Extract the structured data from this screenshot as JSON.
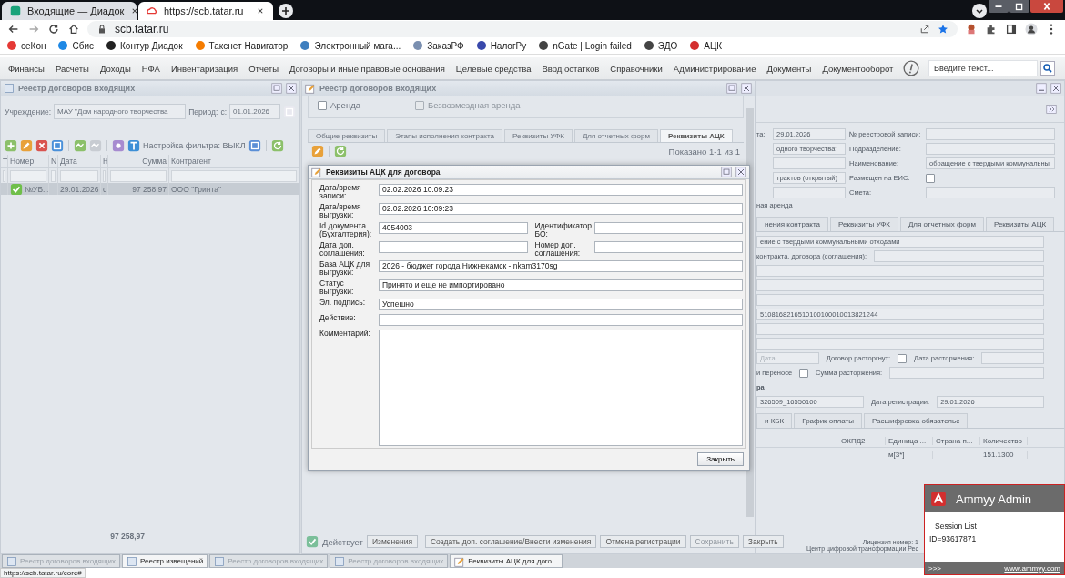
{
  "browser": {
    "tabs": [
      {
        "title": "Входящие — Диадок",
        "selected": false
      },
      {
        "title": "https://scb.tatar.ru",
        "selected": true
      }
    ],
    "address": "scb.tatar.ru",
    "bookmarks": [
      {
        "label": "сеКон",
        "color": "#e53935"
      },
      {
        "label": "Сбис",
        "color": "#1e88e5"
      },
      {
        "label": "Контур Диадок",
        "color": "#222222"
      },
      {
        "label": "Такснет Навигатор",
        "color": "#f57c00"
      },
      {
        "label": "Электронный мага...",
        "color": "#3f7fbf"
      },
      {
        "label": "ЗаказРФ",
        "color": "#7a8fb0"
      },
      {
        "label": "НалогРу",
        "color": "#3949ab"
      },
      {
        "label": "nGate | Login failed",
        "color": "#444444"
      },
      {
        "label": "ЭДО",
        "color": "#444444"
      },
      {
        "label": "АЦК",
        "color": "#d32f2f"
      }
    ]
  },
  "menu": {
    "items": [
      "Финансы",
      "Расчеты",
      "Доходы",
      "НФА",
      "Инвентаризация",
      "Отчеты",
      "Договоры и иные правовые основания",
      "Целевые средства",
      "Ввод остатков",
      "Справочники",
      "Администрирование",
      "Документы",
      "Документооборот"
    ],
    "search_placeholder": "Введите текст..."
  },
  "left_window": {
    "title": "Реестр договоров входящих",
    "institution_label": "Учреждение:",
    "institution": "МАУ \"Дом народного творчества",
    "period_label": "Период:",
    "from_label": "с:",
    "from": "01.01.2026",
    "filter": "Настройка фильтра: ВЫКЛ",
    "columns": [
      "Т",
      "Номер",
      "N",
      "Дата",
      "Н",
      "Сумма",
      "Контрагент"
    ],
    "rows": [
      {
        "selected": true,
        "cells": [
          "",
          "№УБ...",
          "",
          "29.01.2026",
          "с",
          "97 258,97",
          "ООО \"Гринта\""
        ]
      }
    ],
    "total": "97 258,97"
  },
  "middle_window": {
    "title": "Реестр договоров входящих",
    "checkboxes": [
      {
        "label": "Аренда",
        "checked": false,
        "disabled": false
      },
      {
        "label": "Безвозмездная аренда",
        "checked": false,
        "disabled": true
      }
    ],
    "tabs": [
      {
        "label": "Общие реквизиты",
        "selected": false
      },
      {
        "label": "Этапы исполнения контракта",
        "selected": false
      },
      {
        "label": "Реквизиты УФК",
        "selected": false
      },
      {
        "label": "Для отчетных форм",
        "selected": false
      },
      {
        "label": "Реквизиты АЦК",
        "selected": true
      }
    ],
    "shown": "Показано 1-1 из 1",
    "status": "Действует",
    "buttons": [
      {
        "label": "Изменения",
        "disabled": false,
        "kind": "left"
      },
      {
        "label": "Создать доп. соглашение/Внести изменения",
        "disabled": false,
        "kind": "right"
      },
      {
        "label": "Отмена регистрации",
        "disabled": false,
        "kind": "right"
      },
      {
        "label": "Сохранить",
        "disabled": true,
        "kind": "right"
      },
      {
        "label": "Закрыть",
        "disabled": false,
        "kind": "right"
      }
    ]
  },
  "dialog": {
    "title": "Реквизиты АЦК для договора",
    "rows": [
      [
        {
          "kind": "text",
          "label": "Дата/время записи:",
          "value": "02.02.2026 10:09:23"
        }
      ],
      [
        {
          "kind": "text",
          "label": "Дата/время выгрузки:",
          "value": "02.02.2026 10:09:23"
        }
      ],
      [
        {
          "kind": "text",
          "label": "Id документа (Бухгалтерия):",
          "value": "4054003"
        },
        {
          "kind": "text",
          "label": "Идентификатор БО:"
        }
      ],
      [
        {
          "kind": "text",
          "label": "Дата доп. соглашения:"
        },
        {
          "kind": "text",
          "label": "Номер доп. соглашения:"
        }
      ],
      [
        {
          "kind": "text",
          "label": "База АЦК для выгрузки:",
          "value": "2026 - бюджет города Нижнекамск - nkam3170sg"
        }
      ],
      [
        {
          "kind": "text",
          "label": "Статус выгрузки:",
          "value": "Принято и еще не импортировано"
        }
      ],
      [
        {
          "kind": "text",
          "label": "Эл. подпись:",
          "value": "Успешно"
        }
      ],
      [
        {
          "kind": "text",
          "label": "Действие:"
        }
      ],
      [
        {
          "kind": "textarea",
          "label": "Комментарий:"
        }
      ]
    ],
    "button": "Закрыть"
  },
  "right_window": {
    "top_rows": [
      {
        "left_label": "та:",
        "left_field": {
          "value": "29.01.2026"
        },
        "right_label": "№ реестровой записи:",
        "right": {
          "kind": "field"
        }
      },
      {
        "left_field": {
          "value": "одного творчества\""
        },
        "right_label": "Подразделение:",
        "right": {
          "kind": "field"
        }
      },
      {
        "left_field": {},
        "right_label": "Наименование:",
        "right": {
          "kind": "field",
          "value": "обращение с твердыми коммунальны"
        }
      },
      {
        "left_field": {
          "value": "трактов (открытый)"
        },
        "right_label": "Размещен на ЕИС:",
        "right": {
          "kind": "checkbox",
          "checked": false
        }
      },
      {
        "left_field": {},
        "right_label": "Смета:",
        "right": {
          "kind": "field"
        }
      },
      {
        "left_label": "ная аренда"
      }
    ],
    "tabs": [
      {
        "label": "нения контракта",
        "selected": false
      },
      {
        "label": "Реквизиты УФК",
        "selected": false
      },
      {
        "label": "Для отчетных форм",
        "selected": false
      },
      {
        "label": "Реквизиты АЦК",
        "selected": false
      }
    ],
    "form_lines": [
      [
        {
          "kind": "field",
          "value": "ение с твердыми коммунальными отходами"
        }
      ],
      [
        {
          "kind": "label",
          "text": "контракта, договора (соглашения):"
        },
        {
          "kind": "field"
        }
      ],
      [
        {
          "kind": "field"
        }
      ],
      [
        {
          "kind": "field"
        }
      ],
      [
        {
          "kind": "field"
        }
      ],
      [
        {
          "kind": "field",
          "value": "5108168216510100100010013821244"
        }
      ],
      [
        {
          "kind": "field"
        }
      ],
      [
        {
          "kind": "field"
        }
      ],
      [
        {
          "kind": "field",
          "placeholder": "Дата"
        },
        {
          "kind": "label",
          "text": "Договор расторгнут:"
        },
        {
          "kind": "checkbox",
          "checked": false
        },
        {
          "kind": "label",
          "text": "Дата расторжения:"
        },
        {
          "kind": "field"
        }
      ],
      [
        {
          "kind": "label",
          "text": "и переносе"
        },
        {
          "kind": "checkbox",
          "checked": false
        },
        {
          "kind": "label",
          "text": "Сумма расторжения:"
        },
        {
          "kind": "field"
        }
      ],
      [
        {
          "kind": "heading",
          "text": "ра"
        }
      ],
      [
        {
          "kind": "field",
          "value": "326509_16550100"
        },
        {
          "kind": "label",
          "text": "Дата регистрации:"
        },
        {
          "kind": "field",
          "value": "29.01.2026"
        }
      ]
    ],
    "tabs2": [
      {
        "label": "и КБК",
        "selected": false
      },
      {
        "label": "График оплаты",
        "selected": false
      },
      {
        "label": "Расшифровка обязательс",
        "selected": false
      }
    ],
    "columns": [
      "ОКПД2",
      "Единица ...",
      "Страна п...",
      "Количество"
    ],
    "grid_rows": [
      [
        {},
        {
          "text": "м[3*]"
        },
        {},
        {
          "text": "151.1300"
        }
      ]
    ],
    "license": [
      "Лицензия номер: 1",
      "Центр цифровой трансформации Рес"
    ]
  },
  "taskbar": [
    {
      "label": "Реестр договоров входящих",
      "disabled": true
    },
    {
      "label": "Реестр извещений",
      "disabled": false
    },
    {
      "label": "Реестр договоров входящих",
      "disabled": true
    },
    {
      "label": "Реестр договоров входящих",
      "disabled": true
    },
    {
      "label": "Реквизиты АЦК для дого...",
      "disabled": false
    }
  ],
  "status_url": "https://scb.tatar.ru/core#",
  "ammyy": {
    "title": "Ammyy Admin",
    "heading": "Session List",
    "id": "ID=93617871",
    "more": ">>>",
    "link": "www.ammyy.com"
  }
}
